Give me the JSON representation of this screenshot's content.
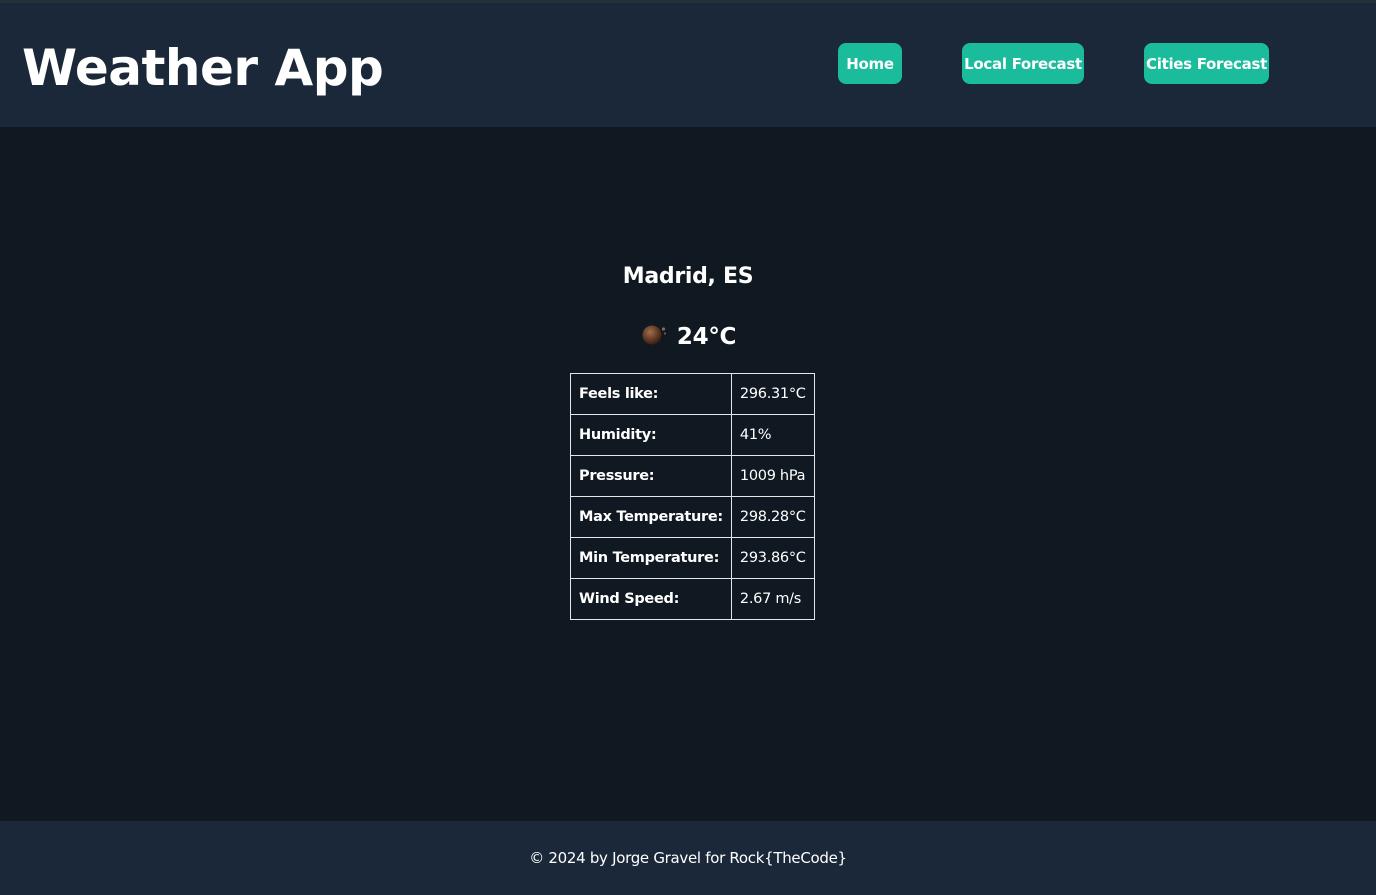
{
  "header": {
    "title": "Weather App",
    "nav": [
      {
        "label": "Home"
      },
      {
        "label": "Local Forecast"
      },
      {
        "label": "Cities Forecast"
      }
    ]
  },
  "weather": {
    "location": "Madrid, ES",
    "icon": "weather-condition-icon",
    "temperature": "24°C",
    "details": [
      {
        "label": "Feels like:",
        "value": "296.31°C"
      },
      {
        "label": "Humidity:",
        "value": "41%"
      },
      {
        "label": "Pressure:",
        "value": "1009 hPa"
      },
      {
        "label": "Max Temperature:",
        "value": "298.28°C"
      },
      {
        "label": "Min Temperature:",
        "value": "293.86°C"
      },
      {
        "label": "Wind Speed:",
        "value": "2.67 m/s"
      }
    ]
  },
  "footer": {
    "text": "© 2024 by Jorge Gravel for Rock{TheCode}"
  },
  "colors": {
    "background": "#101922",
    "header_bg": "#1a2839",
    "accent": "#1abc9c",
    "text": "#ffffff"
  }
}
